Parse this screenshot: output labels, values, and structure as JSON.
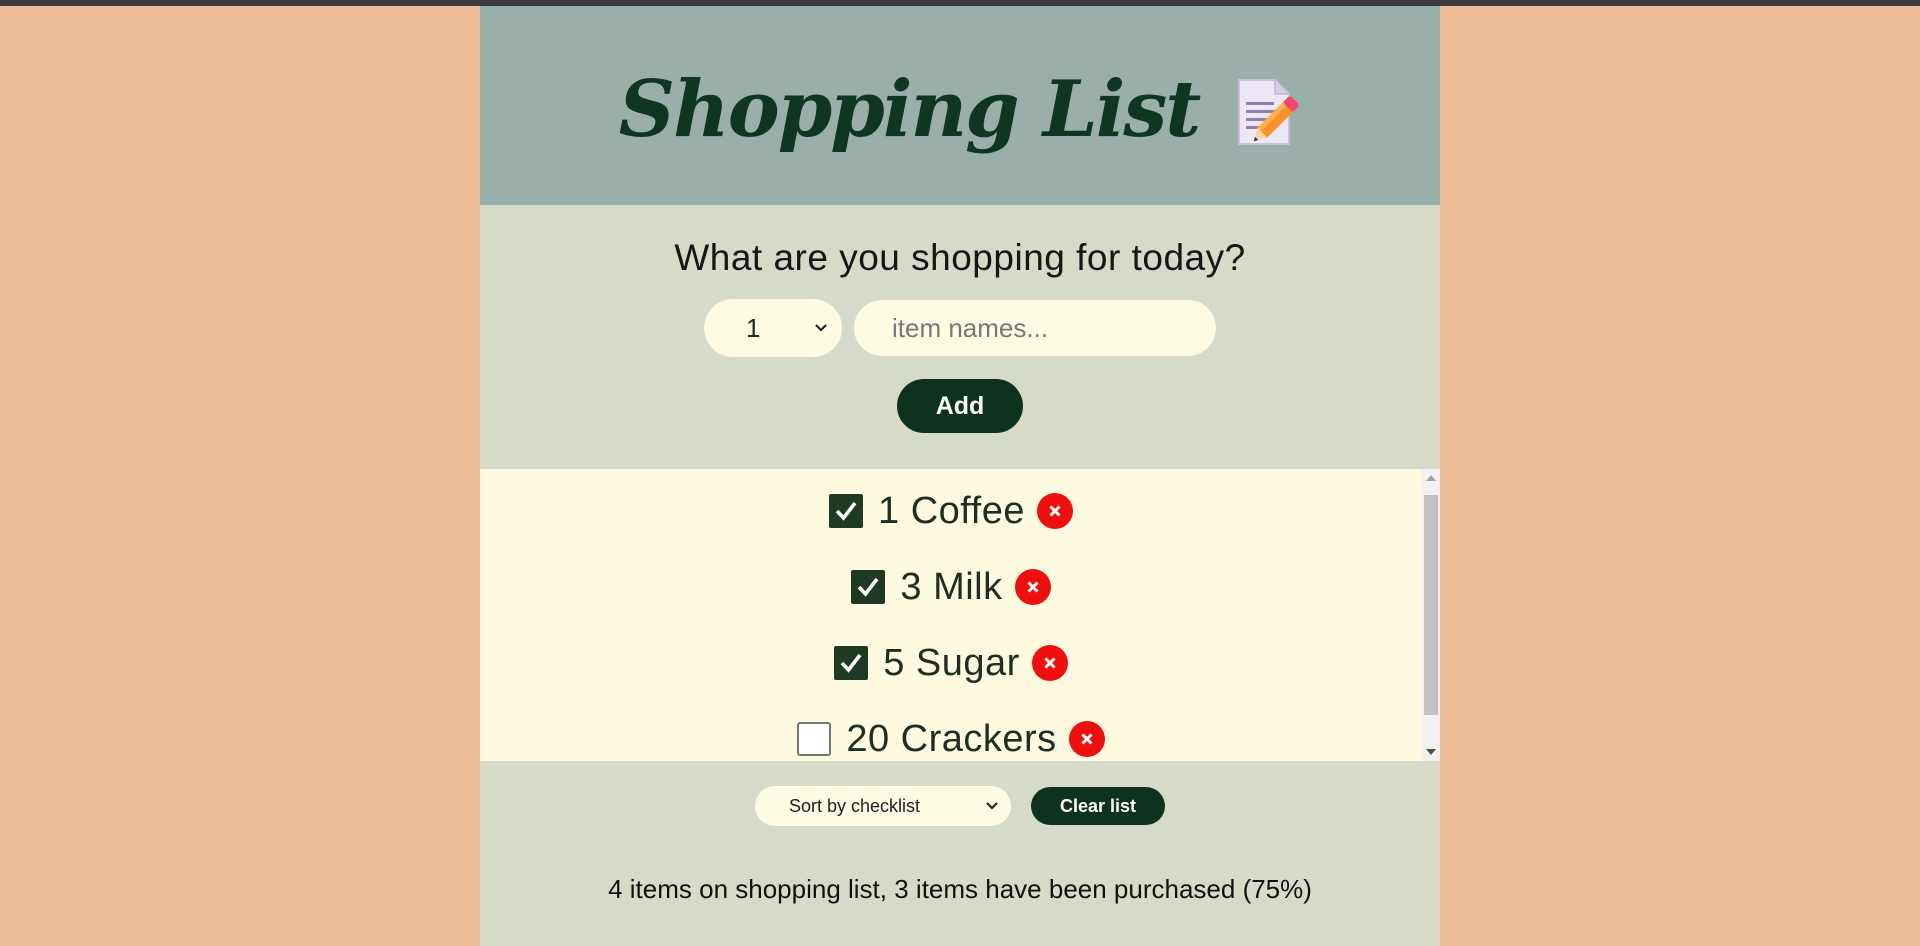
{
  "header": {
    "title": "Shopping List",
    "icon": "memo-icon"
  },
  "form": {
    "prompt": "What are you shopping for today?",
    "quantity_selected": "1",
    "item_placeholder": "item names...",
    "item_value": "",
    "add_label": "Add"
  },
  "list": {
    "items": [
      {
        "quantity": "1",
        "name": "Coffee",
        "text": "1 Coffee",
        "checked": true
      },
      {
        "quantity": "3",
        "name": "Milk",
        "text": "3 Milk",
        "checked": true
      },
      {
        "quantity": "5",
        "name": "Sugar",
        "text": "5 Sugar",
        "checked": true
      },
      {
        "quantity": "20",
        "name": "Crackers",
        "text": "20 Crackers",
        "checked": false
      }
    ]
  },
  "footer": {
    "sort_selected": "Sort by checklist",
    "clear_label": "Clear list",
    "stats": "4 items on shopping list, 3 items have been purchased (75%)"
  },
  "colors": {
    "page_bg": "#eebb99",
    "header_bg": "#9aafaa",
    "panel_bg": "#d5dbc8",
    "list_bg": "#fefadf",
    "accent_dark": "#0f3220",
    "delete_red": "#f00e0e"
  }
}
